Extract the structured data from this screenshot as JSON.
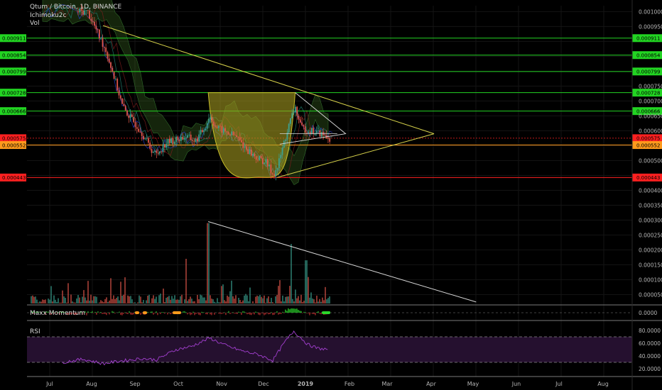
{
  "legend": {
    "symbol": "Qtum / Bitcoin, 1D, BINANCE",
    "indicator1": "Ichimoku2c",
    "indicator2": "Vol"
  },
  "panes": {
    "maxx_title": "Maxx Momentum",
    "rsi_title": "RSI"
  },
  "colors": {
    "background": "#000000",
    "up_candle": "#3aa28f",
    "down_candle": "#e0564a",
    "cloud": "#3d6b22",
    "cup_fill": "#a49a1f",
    "trendline": "#d6d14a",
    "rsi_line": "#a33fd0",
    "rsi_band": "#25102f",
    "green_level": "#22d422",
    "orange_level": "#ff9a1c",
    "red_level": "#ff2020",
    "volume_trendline": "#d8d8d8"
  },
  "chart_data": [
    {
      "type": "candlestick",
      "title": "Qtum / Bitcoin, 1D, BINANCE",
      "x_tick_labels": [
        "Jul",
        "Aug",
        "Sep",
        "Oct",
        "Nov",
        "Dec",
        "2019",
        "Feb",
        "Mar",
        "Apr",
        "May",
        "Jun",
        "Jul",
        "Aug"
      ],
      "y_tick_labels": [
        "0.001000",
        "0.000950",
        "0.000900",
        "0.000850",
        "0.000800",
        "0.000750",
        "0.000700",
        "0.000650",
        "0.000600",
        "0.000550",
        "0.000500",
        "0.000450",
        "0.000400",
        "0.000350",
        "0.000300",
        "0.000250",
        "0.000200",
        "0.000150",
        "0.000100",
        "0.000050"
      ],
      "ylim": [
        2e-05,
        0.00102
      ],
      "price_path": [
        {
          "x": "Jul 28",
          "y": 0.001
        },
        {
          "x": "Aug 4",
          "y": 0.00093
        },
        {
          "x": "Aug 10",
          "y": 0.00087
        },
        {
          "x": "Aug 16",
          "y": 0.00078
        },
        {
          "x": "Aug 22",
          "y": 0.00068
        },
        {
          "x": "Aug 28",
          "y": 0.00064
        },
        {
          "x": "Sep 4",
          "y": 0.0006
        },
        {
          "x": "Sep 11",
          "y": 0.00054
        },
        {
          "x": "Sep 15",
          "y": 0.00052
        },
        {
          "x": "Sep 22",
          "y": 0.00056
        },
        {
          "x": "Sep 29",
          "y": 0.00057
        },
        {
          "x": "Oct 6",
          "y": 0.00058
        },
        {
          "x": "Oct 13",
          "y": 0.000565
        },
        {
          "x": "Oct 20",
          "y": 0.000615
        },
        {
          "x": "Oct 23",
          "y": 0.00065
        },
        {
          "x": "Oct 28",
          "y": 0.00061
        },
        {
          "x": "Nov 4",
          "y": 0.000595
        },
        {
          "x": "Nov 11",
          "y": 0.00058
        },
        {
          "x": "Nov 18",
          "y": 0.00054
        },
        {
          "x": "Nov 25",
          "y": 0.00051
        },
        {
          "x": "Dec 2",
          "y": 0.000495
        },
        {
          "x": "Dec 7",
          "y": 0.000455
        },
        {
          "x": "Dec 10",
          "y": 0.00047
        },
        {
          "x": "Dec 15",
          "y": 0.00056
        },
        {
          "x": "Dec 20",
          "y": 0.00064
        },
        {
          "x": "Dec 23",
          "y": 0.00068
        },
        {
          "x": "Dec 27",
          "y": 0.00061
        },
        {
          "x": "Jan 3",
          "y": 0.0006
        },
        {
          "x": "Jan 10",
          "y": 0.00059
        },
        {
          "x": "Jan 16",
          "y": 0.000575
        }
      ],
      "levels": [
        {
          "value": 0.000911,
          "label": "0.000911",
          "color": "green"
        },
        {
          "value": 0.000854,
          "label": "0.000854",
          "color": "green"
        },
        {
          "value": 0.000799,
          "label": "0.000799",
          "color": "green"
        },
        {
          "value": 0.000728,
          "label": "0.000728",
          "color": "green"
        },
        {
          "value": 0.000666,
          "label": "0.000666",
          "color": "green"
        },
        {
          "value": 0.000575,
          "label": "0.000575",
          "color": "red"
        },
        {
          "value": 0.000552,
          "label": "0.000552",
          "color": "orange"
        },
        {
          "value": 0.000443,
          "label": "0.000443",
          "color": "red"
        }
      ],
      "annotations": [
        {
          "kind": "descending-trendline",
          "from": {
            "x": "Aug 8",
            "y": 0.000953
          },
          "to": {
            "x": "Apr 1",
            "y": 0.00059
          }
        },
        {
          "kind": "ascending-trendline",
          "from": {
            "x": "Dec 10",
            "y": 0.000443
          },
          "to": {
            "x": "Apr 1",
            "y": 0.00059
          }
        },
        {
          "kind": "cup-pattern",
          "from": {
            "x": "Oct 22",
            "y": 0.000728
          },
          "to": {
            "x": "Dec 23",
            "y": 0.000728
          },
          "bottom": {
            "x": "Nov 27",
            "y": 0.000444
          }
        }
      ]
    },
    {
      "type": "bar",
      "title": "Vol",
      "description": "volume histogram, peak near Oct 22 and Dec 20",
      "peaks": [
        {
          "x": "Oct 22",
          "y": 0.00029
        },
        {
          "x": "Dec 20",
          "y": 0.00022
        },
        {
          "x": "Oct 6",
          "y": 0.00017
        },
        {
          "x": "Dec 31",
          "y": 0.000165
        }
      ],
      "trendline": {
        "from": {
          "x": "Oct 22",
          "y": 0.000295
        },
        "to": {
          "x": "May 1",
          "y": 2.5e-05
        }
      }
    },
    {
      "type": "bar",
      "title": "Maxx Momentum",
      "y_tick_labels": [
        "0.0000"
      ]
    },
    {
      "type": "line",
      "title": "RSI",
      "y_tick_labels": [
        "80.0000",
        "60.0000",
        "40.0000",
        "20.0000"
      ],
      "ylim": [
        10,
        90
      ],
      "bands": [
        70,
        30
      ],
      "points": [
        {
          "x": "Jul 10",
          "y": 30
        },
        {
          "x": "Jul 25",
          "y": 35
        },
        {
          "x": "Aug 8",
          "y": 28
        },
        {
          "x": "Aug 20",
          "y": 32
        },
        {
          "x": "Sep 5",
          "y": 36
        },
        {
          "x": "Sep 15",
          "y": 34
        },
        {
          "x": "Sep 29",
          "y": 50
        },
        {
          "x": "Oct 10",
          "y": 55
        },
        {
          "x": "Oct 23",
          "y": 68
        },
        {
          "x": "Nov 5",
          "y": 55
        },
        {
          "x": "Nov 15",
          "y": 48
        },
        {
          "x": "Nov 27",
          "y": 42
        },
        {
          "x": "Dec 7",
          "y": 33
        },
        {
          "x": "Dec 15",
          "y": 60
        },
        {
          "x": "Dec 22",
          "y": 79
        },
        {
          "x": "Jan 1",
          "y": 58
        },
        {
          "x": "Jan 8",
          "y": 52
        },
        {
          "x": "Jan 16",
          "y": 50
        }
      ]
    }
  ]
}
